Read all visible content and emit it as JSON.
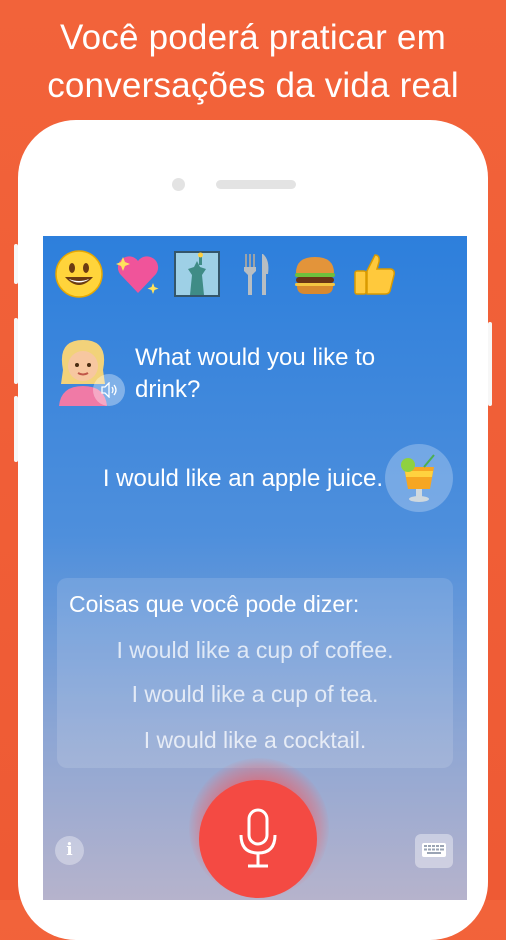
{
  "headline": {
    "line1": "Você poderá praticar em",
    "line2": "conversações da vida real"
  },
  "emoji_bar": [
    {
      "icon": "smiley-icon",
      "glyph": "😃"
    },
    {
      "icon": "sparkling-heart-icon",
      "glyph": "💖"
    },
    {
      "icon": "statue-of-liberty-icon",
      "glyph": "🗽"
    },
    {
      "icon": "fork-and-knife-icon",
      "glyph": "🍴"
    },
    {
      "icon": "hamburger-icon",
      "glyph": "🍔"
    },
    {
      "icon": "thumbs-up-icon",
      "glyph": "👍"
    }
  ],
  "conversation": {
    "question": "What would you like to drink?",
    "answer": "I would like an apple juice."
  },
  "suggestions": {
    "title": "Coisas que você pode dizer:",
    "items": [
      "I would like a cup of coffee.",
      "I would like a cup of tea.",
      "I would like a cocktail."
    ]
  },
  "controls": {
    "info_label": "i"
  },
  "colors": {
    "background": "#f2633a",
    "screen_top": "#2d7fdc",
    "mic": "#f44a43"
  }
}
